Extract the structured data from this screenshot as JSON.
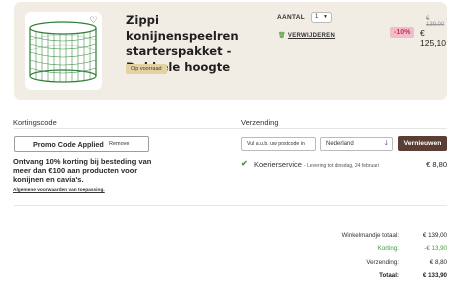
{
  "item": {
    "title": "Zippi konijnenspeelren starterspakket - Dubbele hoogte",
    "stock_badge": "Op voorraad",
    "quantity_label": "AANTAL",
    "quantity_value": "1",
    "remove_label": "VERWIJDEREN",
    "old_price": "€ 139,00",
    "discount_badge": "-10%",
    "new_price": "€ 125,10",
    "icons": {
      "wishlist": "heart-icon",
      "remove": "trash-icon",
      "quantity": "chevron-down-icon"
    }
  },
  "coupon": {
    "heading": "Kortingscode",
    "code": "Promo Code Applied",
    "remove_label": "Remove",
    "promo_text": "Ontvang 10% korting bij besteding van meer dan €100 aan producten voor konijnen en cavia's.",
    "terms_link": "Algemene voorwaarden van toepassing."
  },
  "shipping": {
    "heading": "Verzending",
    "postcode_placeholder": "Vul a.u.b. uw postcode in",
    "country": "Nederland",
    "renew_button": "Vernieuwen",
    "service_name": "Koerierservice",
    "service_detail": "- Levering tot dinsdag, 24 februari",
    "service_price": "€ 8,80"
  },
  "totals": {
    "subtotal_label": "Winkelmandje totaal:",
    "subtotal_value": "€ 139,00",
    "discount_label": "Korting:",
    "discount_value": "-€ 13,90",
    "shipping_label": "Verzending:",
    "shipping_value": "€ 8,80",
    "total_label": "Totaal:",
    "total_value": "€ 133,90"
  },
  "colors": {
    "card_bg": "#f1ede4",
    "accent_brown": "#5a3d33",
    "discount_pink": "#f3bcc9",
    "discount_text": "#c23463",
    "success_green": "#3e9a3e",
    "stock_badge": "#e3d3a2"
  }
}
